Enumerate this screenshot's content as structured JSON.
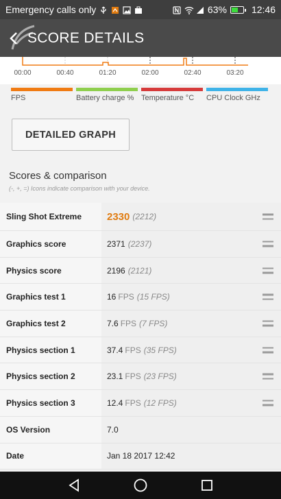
{
  "status_bar": {
    "carrier_text": "Emergency calls only",
    "battery_percent": "63%",
    "time": "12:46",
    "battery_level": 0.63
  },
  "app_bar": {
    "title": "SCORE DETAILS"
  },
  "graph": {
    "ticks": [
      "00:00",
      "00:40",
      "01:20",
      "02:00",
      "02:40",
      "03:20"
    ],
    "line_color": "#f07b13"
  },
  "legend": [
    {
      "label": "FPS",
      "color": "#f07b13"
    },
    {
      "label": "Battery charge %",
      "color": "#8fcf4e"
    },
    {
      "label": "Temperature °C",
      "color": "#d63b3b"
    },
    {
      "label": "CPU Clock GHz",
      "color": "#3fb3e8"
    }
  ],
  "detailed_graph_button": "DETAILED GRAPH",
  "scores": {
    "title": "Scores & comparison",
    "subtitle": "(-, +, =) Icons indicate comparison with your device.",
    "rows": [
      {
        "label": "Sling Shot Extreme",
        "value": "2330",
        "unit": "",
        "comparison": "(2212)"
      },
      {
        "label": "Graphics score",
        "value": "2371",
        "unit": "",
        "comparison": "(2237)"
      },
      {
        "label": "Physics score",
        "value": "2196",
        "unit": "",
        "comparison": "(2121)"
      },
      {
        "label": "Graphics test 1",
        "value": "16",
        "unit": "FPS",
        "comparison": "(15 FPS)"
      },
      {
        "label": "Graphics test 2",
        "value": "7.6",
        "unit": "FPS",
        "comparison": "(7 FPS)"
      },
      {
        "label": "Physics section 1",
        "value": "37.4",
        "unit": "FPS",
        "comparison": "(35 FPS)"
      },
      {
        "label": "Physics section 2",
        "value": "23.1",
        "unit": "FPS",
        "comparison": "(23 FPS)"
      },
      {
        "label": "Physics section 3",
        "value": "12.4",
        "unit": "FPS",
        "comparison": "(12 FPS)"
      },
      {
        "label": "OS Version",
        "value": "7.0",
        "unit": "",
        "comparison": ""
      },
      {
        "label": "Date",
        "value": "Jan 18 2017 12:42",
        "unit": "",
        "comparison": ""
      }
    ]
  },
  "nav_bar": {
    "back": "back-icon",
    "home": "home-icon",
    "recents": "recents-icon"
  }
}
